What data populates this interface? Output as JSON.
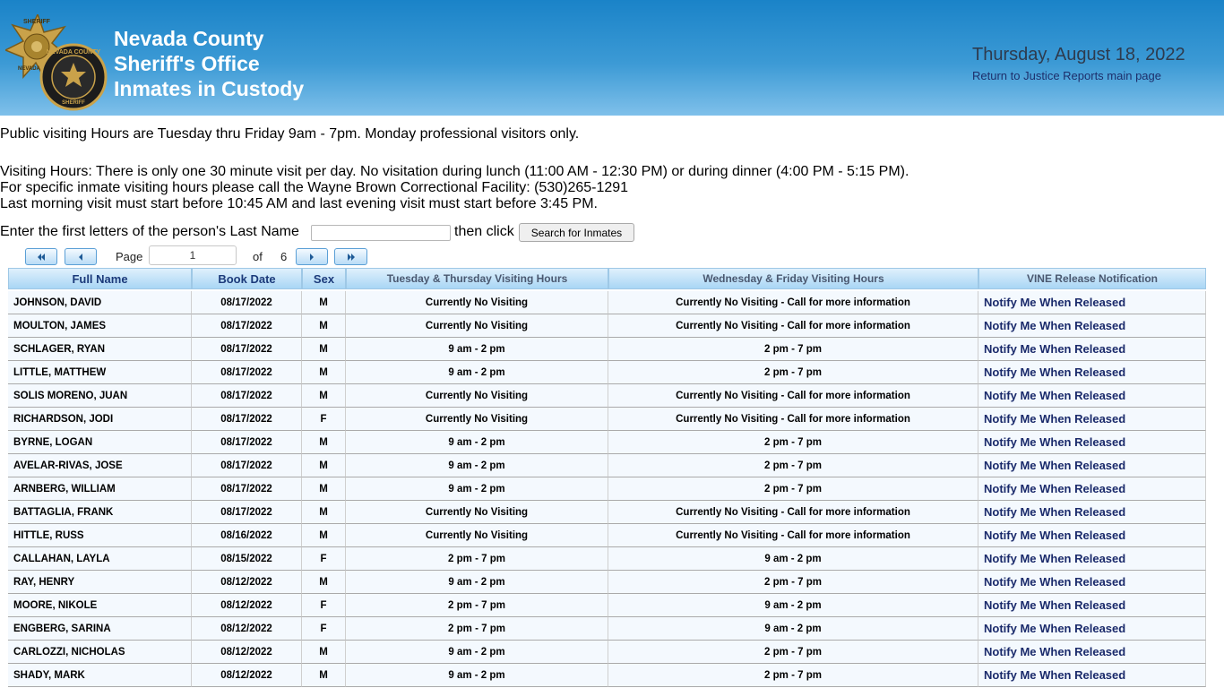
{
  "header": {
    "title_lines": [
      "Nevada County",
      "Sheriff's Office",
      "Inmates in Custody"
    ],
    "date": "Thursday, August 18, 2022",
    "return_link": "Return to Justice Reports main page",
    "badge_text_1": "SHERIFF",
    "badge_text_2": "NEVADA",
    "badge_text_3": "NEVADA COUNTY",
    "badge_text_4": "SHERIFF",
    "brand_color": "#1a83c8"
  },
  "notices": {
    "public_hours": "Public visiting Hours are Tuesday thru Friday 9am - 7pm. Monday professional visitors only.",
    "visiting_hours": "Visiting Hours:  There is only one 30 minute visit per day.  No visitation during lunch (11:00 AM - 12:30 PM) or during dinner (4:00 PM - 5:15 PM).",
    "specific_hours": "For specific inmate visiting hours please call the Wayne Brown Correctional Facility: (530)265-1291",
    "last_visit": "Last morning visit must start before 10:45 AM and last evening visit must start before 3:45 PM."
  },
  "search": {
    "prompt": "Enter the first letters of the person's Last Name",
    "then_click": "then click",
    "button_label": "Search for Inmates",
    "input_value": ""
  },
  "pager": {
    "page_label": "Page",
    "current_page": "1",
    "of_label": "of",
    "total_pages": "6",
    "icons": [
      "first-page-icon",
      "prev-page-icon",
      "next-page-icon",
      "last-page-icon"
    ]
  },
  "table": {
    "headers": [
      "Full Name",
      "Book Date",
      "Sex",
      "Tuesday & Thursday Visiting Hours",
      "Wednesday & Friday Visiting Hours",
      "VINE Release Notification"
    ],
    "rows": [
      [
        "JOHNSON, DAVID",
        "08/17/2022",
        "M",
        "Currently No Visiting",
        "Currently No Visiting - Call for more information",
        "Notify Me When Released"
      ],
      [
        "MOULTON, JAMES",
        "08/17/2022",
        "M",
        "Currently No Visiting",
        "Currently No Visiting - Call for more information",
        "Notify Me When Released"
      ],
      [
        "SCHLAGER, RYAN",
        "08/17/2022",
        "M",
        "9 am - 2 pm",
        "2 pm - 7 pm",
        "Notify Me When Released"
      ],
      [
        "LITTLE, MATTHEW",
        "08/17/2022",
        "M",
        "9 am - 2 pm",
        "2 pm - 7 pm",
        "Notify Me When Released"
      ],
      [
        "SOLIS MORENO, JUAN",
        "08/17/2022",
        "M",
        "Currently No Visiting",
        "Currently No Visiting - Call for more information",
        "Notify Me When Released"
      ],
      [
        "RICHARDSON, JODI",
        "08/17/2022",
        "F",
        "Currently No Visiting",
        "Currently No Visiting - Call for more information",
        "Notify Me When Released"
      ],
      [
        "BYRNE, LOGAN",
        "08/17/2022",
        "M",
        "9 am - 2 pm",
        "2 pm - 7 pm",
        "Notify Me When Released"
      ],
      [
        "AVELAR-RIVAS, JOSE",
        "08/17/2022",
        "M",
        "9 am - 2 pm",
        "2 pm - 7 pm",
        "Notify Me When Released"
      ],
      [
        "ARNBERG, WILLIAM",
        "08/17/2022",
        "M",
        "9 am - 2 pm",
        "2 pm - 7 pm",
        "Notify Me When Released"
      ],
      [
        "BATTAGLIA, FRANK",
        "08/17/2022",
        "M",
        "Currently No Visiting",
        "Currently No Visiting - Call for more information",
        "Notify Me When Released"
      ],
      [
        "HITTLE, RUSS",
        "08/16/2022",
        "M",
        "Currently No Visiting",
        "Currently No Visiting - Call for more information",
        "Notify Me When Released"
      ],
      [
        "CALLAHAN, LAYLA",
        "08/15/2022",
        "F",
        "2 pm - 7 pm",
        "9 am - 2 pm",
        "Notify Me When Released"
      ],
      [
        "RAY, HENRY",
        "08/12/2022",
        "M",
        "9 am - 2 pm",
        "2 pm - 7 pm",
        "Notify Me When Released"
      ],
      [
        "MOORE, NIKOLE",
        "08/12/2022",
        "F",
        "2 pm - 7 pm",
        "9 am - 2 pm",
        "Notify Me When Released"
      ],
      [
        "ENGBERG, SARINA",
        "08/12/2022",
        "F",
        "2 pm - 7 pm",
        "9 am - 2 pm",
        "Notify Me When Released"
      ],
      [
        "CARLOZZI, NICHOLAS",
        "08/12/2022",
        "M",
        "9 am - 2 pm",
        "2 pm - 7 pm",
        "Notify Me When Released"
      ],
      [
        "SHADY, MARK",
        "08/12/2022",
        "M",
        "9 am - 2 pm",
        "2 pm - 7 pm",
        "Notify Me When Released"
      ]
    ]
  }
}
